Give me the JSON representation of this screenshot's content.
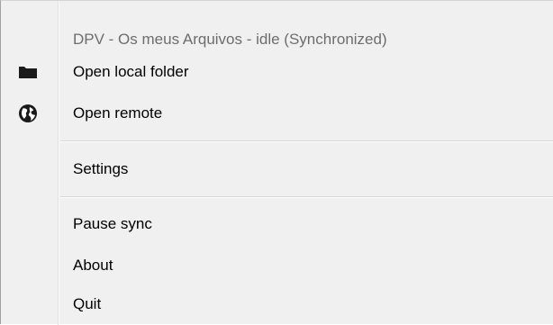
{
  "context_menu": {
    "status_label": "DPV - Os meus Arquivos - idle (Synchronized)",
    "items": [
      {
        "label": "Open local folder",
        "icon": "folder-icon"
      },
      {
        "label": "Open remote",
        "icon": "globe-icon"
      },
      {
        "label": "Settings"
      },
      {
        "label": "Pause sync"
      },
      {
        "label": "About"
      },
      {
        "label": "Quit"
      }
    ]
  }
}
